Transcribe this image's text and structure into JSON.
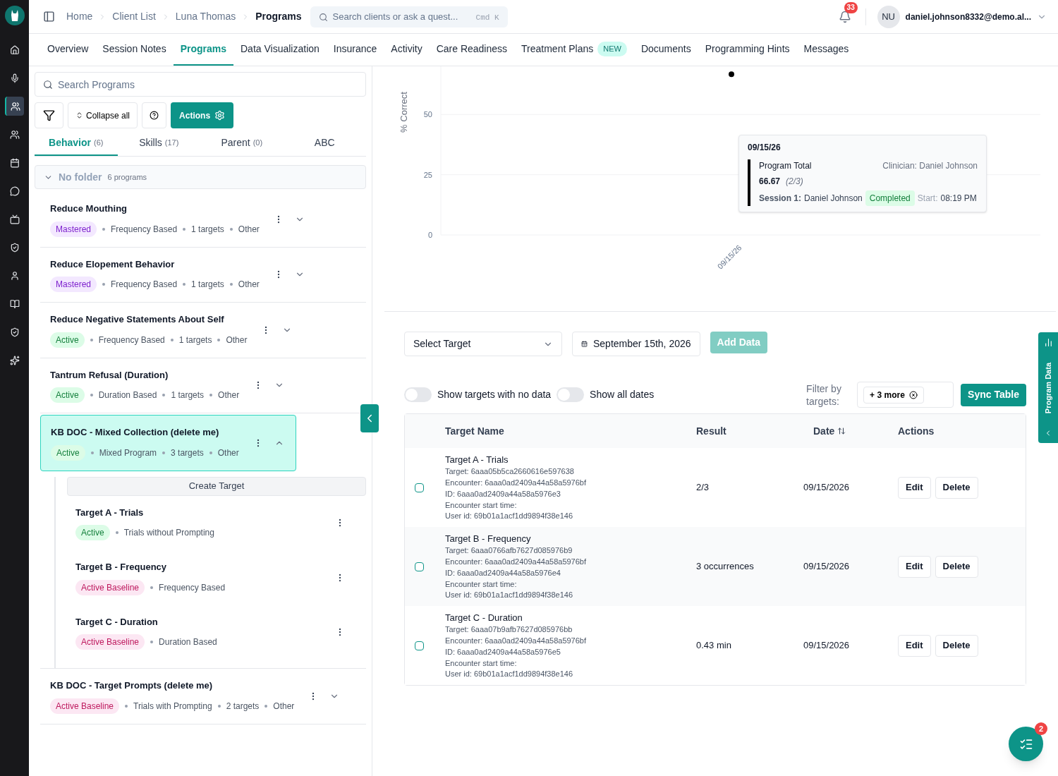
{
  "sidebar": {
    "items": [
      {
        "selected": false
      },
      {
        "selected": false
      },
      {
        "selected": true
      },
      {
        "selected": false
      },
      {
        "selected": false
      },
      {
        "selected": false
      },
      {
        "selected": false
      },
      {
        "selected": false
      },
      {
        "selected": false
      },
      {
        "selected": false
      },
      {
        "selected": false
      },
      {
        "selected": false
      }
    ]
  },
  "breadcrumbs": [
    "Home",
    "Client List",
    "Luna Thomas",
    "Programs"
  ],
  "search": {
    "placeholder": "Search clients or ask a quest...",
    "shortcut": "Cmd K"
  },
  "notifications": {
    "count": "33"
  },
  "user": {
    "initials": "NU",
    "email": "daniel.johnson8332@demo.al..."
  },
  "tabs": [
    {
      "label": "Overview",
      "selected": false
    },
    {
      "label": "Session Notes",
      "selected": false
    },
    {
      "label": "Programs",
      "selected": true
    },
    {
      "label": "Data Visualization",
      "selected": false
    },
    {
      "label": "Insurance",
      "selected": false
    },
    {
      "label": "Activity",
      "selected": false
    },
    {
      "label": "Care Readiness",
      "selected": false
    },
    {
      "label": "Treatment Plans",
      "selected": false,
      "badge": "NEW"
    },
    {
      "label": "Documents",
      "selected": false
    },
    {
      "label": "Programming Hints",
      "selected": false
    },
    {
      "label": "Messages",
      "selected": false
    }
  ],
  "programs_panel": {
    "search_placeholder": "Search Programs",
    "collapse_label": "Collapse all",
    "actions_label": "Actions",
    "subtabs": [
      {
        "label": "Behavior",
        "count": "(6)",
        "selected": true
      },
      {
        "label": "Skills",
        "count": "(17)",
        "selected": false
      },
      {
        "label": "Parent",
        "count": "(0)",
        "selected": false
      },
      {
        "label": "ABC",
        "selected": false
      }
    ],
    "folder": {
      "name": "No folder",
      "count": "6 programs",
      "expanded": true
    },
    "programs": [
      {
        "title": "Reduce Mouthing",
        "status": {
          "text": "Mastered",
          "kind": "mastered"
        },
        "details": [
          "Frequency Based",
          "1 targets",
          "Other"
        ],
        "selected": false,
        "expanded": false
      },
      {
        "title": "Reduce Elopement Behavior",
        "status": {
          "text": "Mastered",
          "kind": "mastered"
        },
        "details": [
          "Frequency Based",
          "1 targets",
          "Other"
        ],
        "selected": false,
        "expanded": false
      },
      {
        "title": "Reduce Negative Statements About Self",
        "status": {
          "text": "Active",
          "kind": "active"
        },
        "details": [
          "Frequency Based",
          "1 targets",
          "Other"
        ],
        "selected": false,
        "expanded": false
      },
      {
        "title": "Tantrum Refusal (Duration)",
        "status": {
          "text": "Active",
          "kind": "active"
        },
        "details": [
          "Duration Based",
          "1 targets",
          "Other"
        ],
        "selected": false,
        "expanded": false
      },
      {
        "title": "KB DOC - Mixed Collection (delete me)",
        "status": {
          "text": "Active",
          "kind": "active"
        },
        "details": [
          "Mixed Program",
          "3 targets",
          "Other"
        ],
        "selected": true,
        "expanded": true,
        "create_label": "Create Target",
        "children": [
          {
            "title": "Target A - Trials",
            "status": {
              "text": "Active",
              "kind": "active"
            },
            "details": [
              "Trials without Prompting"
            ]
          },
          {
            "title": "Target B - Frequency",
            "status": {
              "text": "Active Baseline",
              "kind": "baseline"
            },
            "details": [
              "Frequency Based"
            ]
          },
          {
            "title": "Target C - Duration",
            "status": {
              "text": "Active Baseline",
              "kind": "baseline"
            },
            "details": [
              "Duration Based"
            ]
          }
        ]
      },
      {
        "title": "KB DOC - Target Prompts (delete me)",
        "status": {
          "text": "Active Baseline",
          "kind": "baseline"
        },
        "details": [
          "Trials with Prompting",
          "2 targets",
          "Other"
        ],
        "selected": false,
        "expanded": false
      }
    ]
  },
  "chart": {
    "chart_data": {
      "type": "line",
      "ylabel": "% Correct",
      "categories": [
        "09/15/26"
      ],
      "series": [
        {
          "name": "Program Total",
          "color": "#000000",
          "values": [
            66.67
          ],
          "marker": true
        }
      ],
      "yticks": [
        0,
        25,
        50
      ],
      "ylim": [
        0,
        70
      ]
    },
    "tooltip": {
      "date": "09/15/26",
      "clinician": "Clinician: Daniel Johnson",
      "value": "66.67",
      "fraction": "(2/3)",
      "session_label": "Session 1:",
      "session_name": "Daniel Johnson",
      "session_status": "Completed",
      "start_label": "Start:",
      "start_time": "08:19 PM"
    }
  },
  "data_controls": {
    "target_select": "Select Target",
    "date": "September 15th, 2026",
    "add_button": "Add Data",
    "toggles": [
      {
        "label": "Show targets with no data",
        "on": false
      },
      {
        "label": "Show all dates",
        "on": false
      }
    ],
    "filter_label": "Filter by targets:",
    "filter_chip": "+ 3 more",
    "sync_button": "Sync Table"
  },
  "table": {
    "columns": [
      "Target Name",
      "Result",
      "Date",
      "Actions"
    ],
    "rows": [
      {
        "checked": false,
        "name": "Target A - Trials",
        "lines": [
          "Target: 6aaa05b5ca2660616e597638",
          "Encounter: 6aaa0ad2409a44a58a5976bf",
          "ID: 6aaa0ad2409a44a58a5976e3",
          "Encounter start time:",
          "User id: 69b01a1acf1dd9894f38e146"
        ],
        "result": "2/3",
        "date": "09/15/2026",
        "actions": [
          "Edit",
          "Delete"
        ]
      },
      {
        "checked": false,
        "name": "Target B - Frequency",
        "lines": [
          "Target: 6aaa0766afb7627d085976b9",
          "Encounter: 6aaa0ad2409a44a58a5976bf",
          "ID: 6aaa0ad2409a44a58a5976e4",
          "Encounter start time:",
          "User id: 69b01a1acf1dd9894f38e146"
        ],
        "result": "3 occurrences",
        "date": "09/15/2026",
        "actions": [
          "Edit",
          "Delete"
        ]
      },
      {
        "checked": false,
        "name": "Target C - Duration",
        "lines": [
          "Target: 6aaa07b9afb7627d085976bb",
          "Encounter: 6aaa0ad2409a44a58a5976bf",
          "ID: 6aaa0ad2409a44a58a5976e5",
          "Encounter start time:",
          "User id: 69b01a1acf1dd9894f38e146"
        ],
        "result": "0.43 min",
        "date": "09/15/2026",
        "actions": [
          "Edit",
          "Delete"
        ]
      }
    ]
  },
  "side_tab": {
    "label": "Program Data"
  },
  "fab": {
    "count": "2"
  }
}
